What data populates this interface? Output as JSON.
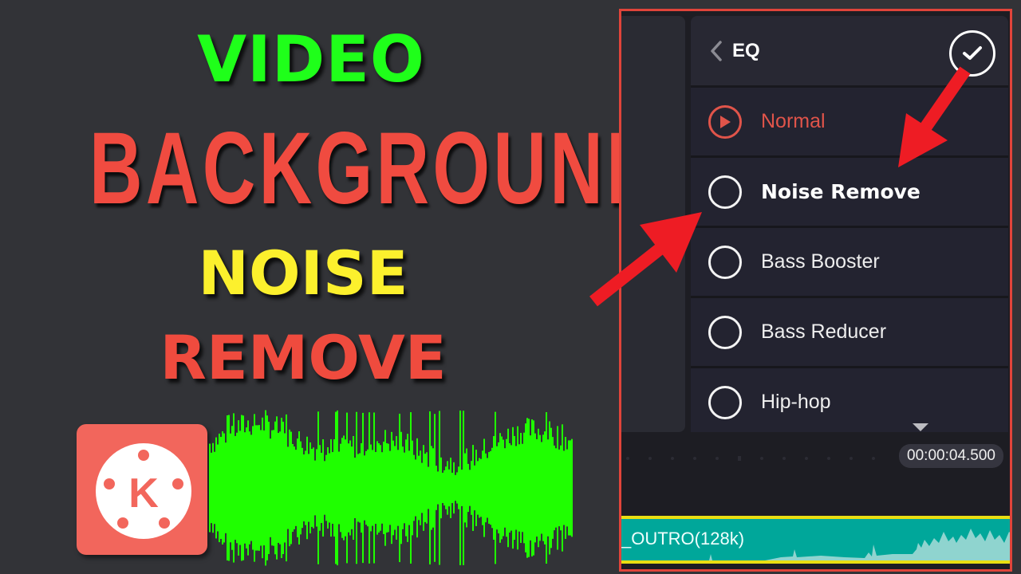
{
  "thumbnail": {
    "title_lines": [
      {
        "text": "VIDEO",
        "color": "#1fff1a"
      },
      {
        "text": "BACKGROUND",
        "color": "#f04b40"
      },
      {
        "text": "NOISE",
        "color": "#fcf02d"
      },
      {
        "text": "REMOVE",
        "color": "#ef4b3e"
      }
    ],
    "logo": {
      "letter": "K",
      "icon": "kinemaster-logo-icon"
    },
    "waveform_icon": "audio-waveform-icon"
  },
  "app": {
    "header": {
      "back_icon": "chevron-left-icon",
      "title": "EQ",
      "confirm_icon": "checkmark-circle-icon"
    },
    "eq_presets": [
      {
        "label": "Normal",
        "selected": true,
        "icon": "play-circle-icon"
      },
      {
        "label": "Noise Remove",
        "selected": false,
        "icon": "radio-empty-icon",
        "highlighted": true
      },
      {
        "label": "Bass Booster",
        "selected": false,
        "icon": "radio-empty-icon"
      },
      {
        "label": "Bass Reducer",
        "selected": false,
        "icon": "radio-empty-icon"
      },
      {
        "label": "Hip-hop",
        "selected": false,
        "icon": "radio-empty-icon"
      }
    ],
    "timeline": {
      "timecode": "00:00:04.500",
      "audio_track_label": "_OUTRO(128k)"
    },
    "colors": {
      "accent": "#e0544a",
      "track": "#00a79a",
      "track_border": "#e9de12",
      "annotation_arrow": "#ee1c24"
    }
  }
}
